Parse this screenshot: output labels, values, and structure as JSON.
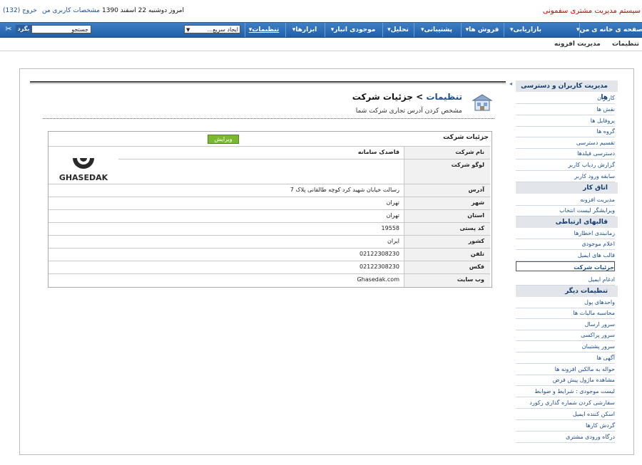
{
  "header": {
    "brand": "سیستم مدیریت مشتری سفمونی",
    "date_text": "امروز دوشنبه 22 اسفند 1390",
    "profile_link": "مشخصات کاربری من",
    "logout_link": "خروج (132)"
  },
  "nav": {
    "items": [
      {
        "label": "صفحه ی خانه ی من▾"
      },
      {
        "label": "بازاریابی▾"
      },
      {
        "label": "فروش ها▾"
      },
      {
        "label": "پشتیبانی▾"
      },
      {
        "label": "تحلیل▾"
      },
      {
        "label": "موجودی انبار▾"
      },
      {
        "label": "ابزارها▾"
      },
      {
        "label": "تنظیمات▾"
      }
    ],
    "quick_create": "ایجاد سریع...",
    "search_placeholder": "جستجو",
    "search_button": "بگرد"
  },
  "subnav": {
    "items": [
      "تنظیمات",
      "مدیریت افزونه"
    ]
  },
  "sidebar": {
    "sections": [
      {
        "title": "مدیریت کاربران و دسترسی ها",
        "items": [
          "کاربران",
          "نقش ها",
          "پروفایل ها",
          "گروه ها",
          "تقسیم دسترسی",
          "دسترسی فیلدها",
          "گزارش ردیاب کاربر",
          "سابقه ورود کاربر"
        ]
      },
      {
        "title": "اتاق کار",
        "items": [
          "مدیریت افزونه",
          "ویرایشگر لیست انتخاب"
        ]
      },
      {
        "title": "قالبهای ارتباطی",
        "items": [
          "زمانبندی اخطارها",
          "اعلام موجودی",
          "قالب های ایمیل",
          "جزئیات شرکت",
          "ادغام ایمیل"
        ]
      },
      {
        "title": "تنظیمات دیگر",
        "items": [
          "واحدهای پول",
          "محاسبه مالیات ها",
          "سرور ارسال",
          "سرور پراکسی",
          "سرور پشتیبان",
          "آگهی ها",
          "حواله به مالکین افزونه ها",
          "مشاهده ماژول پیش فرض",
          "لیست موجودی : شرایط و ضوابط",
          "سفارشی کردن شماره گذاری رکورد",
          "اسکن کننده ایمیل",
          "گردش کارها",
          "درگاه ورودی مشتری"
        ]
      }
    ],
    "active_item": "جزئیات شرکت"
  },
  "page": {
    "breadcrumb_link": "تنظیمات",
    "separator": ">",
    "title": "جزئیات شرکت",
    "subtitle": "مشخص کردن آدرس تجاری شرکت شما",
    "detail_title": "جزئیات شرکت",
    "edit_button": "ویرایش",
    "logo_text": "GHASEDAK",
    "rows": [
      {
        "label": "نام شرکت",
        "value": "قاصدک سامانه"
      },
      {
        "label": "لوگو شرکت",
        "value": ""
      },
      {
        "label": "آدرس",
        "value": "رسالت خیابان شهید کرد کوچه طالقانی پلاک 7"
      },
      {
        "label": "شهر",
        "value": "تهران"
      },
      {
        "label": "استان",
        "value": "تهران"
      },
      {
        "label": "کد پستی",
        "value": "19558"
      },
      {
        "label": "کشور",
        "value": "ایران"
      },
      {
        "label": "تلفن",
        "value": "02122308230"
      },
      {
        "label": "فکس",
        "value": "02122308230"
      },
      {
        "label": "وب سایت",
        "value": "Ghasedak.com"
      }
    ]
  },
  "colors": {
    "nav_bg": "#2a6bb3",
    "brand": "#d00000",
    "link": "#1d4f91",
    "edit_button": "#7ab92e"
  }
}
